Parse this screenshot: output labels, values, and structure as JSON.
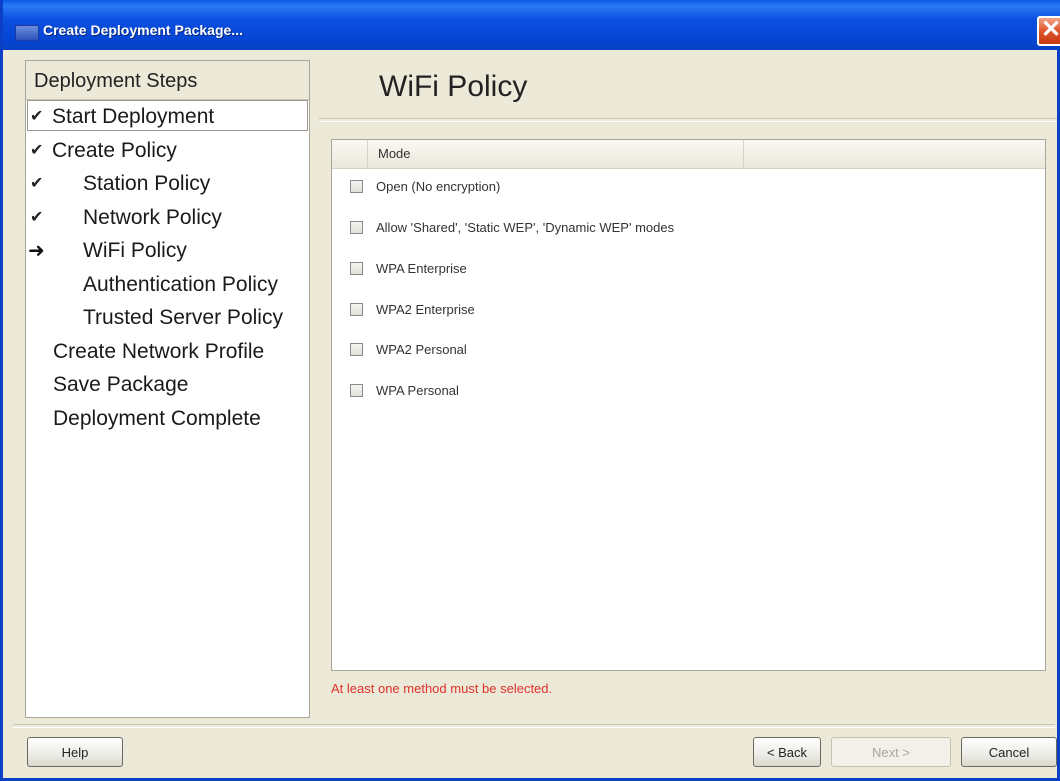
{
  "window": {
    "title": "Create Deployment Package..."
  },
  "steps": {
    "header": "Deployment Steps",
    "items": [
      {
        "label": "Start Deployment",
        "status": "done"
      },
      {
        "label": "Create Policy",
        "status": "done"
      },
      {
        "label": "Station Policy",
        "status": "done"
      },
      {
        "label": "Network Policy",
        "status": "done"
      },
      {
        "label": "WiFi Policy",
        "status": "current"
      },
      {
        "label": "Authentication Policy",
        "status": "pending"
      },
      {
        "label": "Trusted Server Policy",
        "status": "pending"
      },
      {
        "label": "Create Network Profile",
        "status": "pending"
      },
      {
        "label": "Save Package",
        "status": "pending"
      },
      {
        "label": "Deployment Complete",
        "status": "pending"
      }
    ]
  },
  "main": {
    "title": "WiFi Policy",
    "table": {
      "column_header": "Mode",
      "rows": [
        {
          "label": "Open (No encryption)",
          "checked": false
        },
        {
          "label": "Allow 'Shared', 'Static WEP', 'Dynamic WEP' modes",
          "checked": false
        },
        {
          "label": "WPA Enterprise",
          "checked": false
        },
        {
          "label": "WPA2 Enterprise",
          "checked": false
        },
        {
          "label": "WPA2 Personal",
          "checked": false
        },
        {
          "label": "WPA Personal",
          "checked": false
        }
      ]
    },
    "error_message": "At least one method must be selected."
  },
  "buttons": {
    "help": "Help",
    "back": "< Back",
    "next": "Next >",
    "cancel": "Cancel"
  },
  "icons": {
    "done": "check-icon",
    "current": "arrow-right-icon"
  },
  "colors": {
    "titlebar": "#0a4fe0",
    "error": "#e0312b"
  }
}
